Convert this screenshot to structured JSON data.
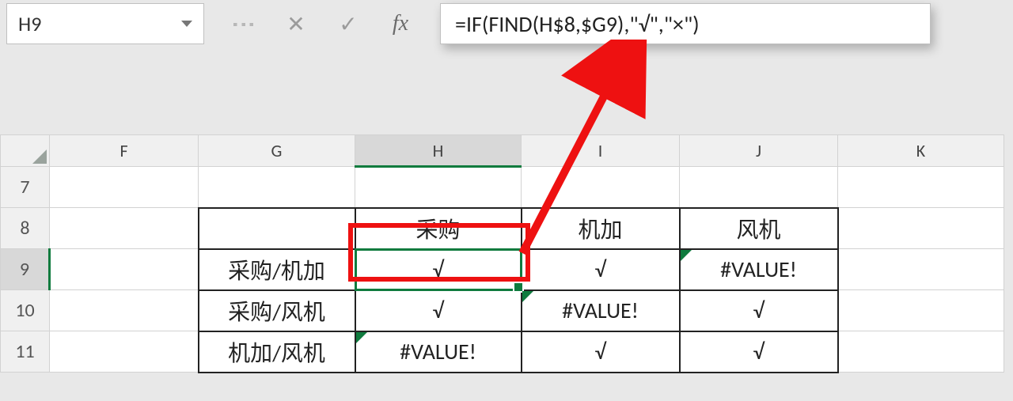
{
  "nameBox": {
    "value": "H9"
  },
  "formulaBar": {
    "cancel_icon": "✕",
    "confirm_icon": "✓",
    "fx_label": "fx",
    "formula": "=IF(FIND(H$8,$G9),\"√\",\"×\")"
  },
  "columns": [
    "F",
    "G",
    "H",
    "I",
    "J",
    "K"
  ],
  "rows": [
    "7",
    "8",
    "9",
    "10",
    "11"
  ],
  "selected": {
    "col": "H",
    "row": "9"
  },
  "cells": {
    "r8": {
      "G": "",
      "H": "采购",
      "I": "机加",
      "J": "风机"
    },
    "r9": {
      "G": "采购/机加",
      "H": "√",
      "I": "√",
      "J": "#VALUE!"
    },
    "r10": {
      "G": "采购/风机",
      "H": "√",
      "I": "#VALUE!",
      "J": "√"
    },
    "r11": {
      "G": "机加/风机",
      "H": "#VALUE!",
      "I": "√",
      "J": "√"
    }
  }
}
